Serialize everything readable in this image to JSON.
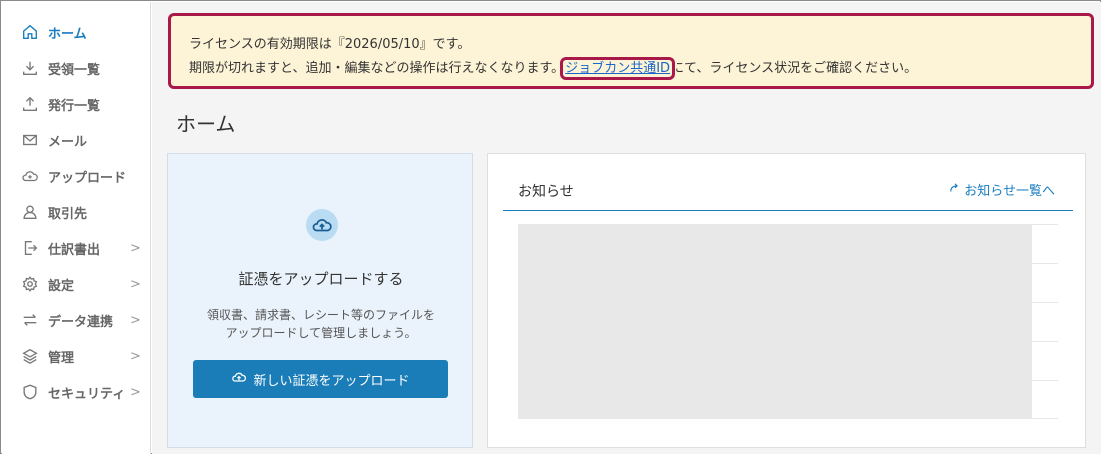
{
  "sidebar": {
    "items": [
      {
        "label": "ホーム",
        "icon": "home-icon",
        "active": true,
        "chevron": ""
      },
      {
        "label": "受領一覧",
        "icon": "download-icon",
        "active": false,
        "chevron": ""
      },
      {
        "label": "発行一覧",
        "icon": "upload-icon",
        "active": false,
        "chevron": ""
      },
      {
        "label": "メール",
        "icon": "mail-icon",
        "active": false,
        "chevron": ""
      },
      {
        "label": "アップロード",
        "icon": "cloud-upload-icon",
        "active": false,
        "chevron": ""
      },
      {
        "label": "取引先",
        "icon": "user-icon",
        "active": false,
        "chevron": ""
      },
      {
        "label": "仕訳書出",
        "icon": "export-icon",
        "active": false,
        "chevron": ">"
      },
      {
        "label": "設定",
        "icon": "gear-icon",
        "active": false,
        "chevron": ">"
      },
      {
        "label": "データ連携",
        "icon": "sync-icon",
        "active": false,
        "chevron": ">"
      },
      {
        "label": "管理",
        "icon": "layers-icon",
        "active": false,
        "chevron": ">"
      },
      {
        "label": "セキュリティ",
        "icon": "shield-icon",
        "active": false,
        "chevron": ">"
      }
    ]
  },
  "banner": {
    "line1": "ライセンスの有効期限は『2026/05/10』です。",
    "line2_before": "期限が切れますと、追加・編集などの操作は行えなくなります。",
    "link": "ジョブカン共通ID",
    "line2_after": "にて、ライセンス状況をご確認ください。"
  },
  "page": {
    "title": "ホーム"
  },
  "upload_card": {
    "title": "証憑をアップロードする",
    "desc_line1": "領収書、請求書、レシート等のファイルを",
    "desc_line2": "アップロードして管理しましょう。",
    "button_label": "新しい証憑をアップロード"
  },
  "news": {
    "title": "お知らせ",
    "link": "お知らせ一覧へ"
  },
  "colors": {
    "accent": "#1a7dc0",
    "banner_bg": "#fdf3d6",
    "highlight_border": "#a8194a",
    "button_bg": "#1a7db8"
  }
}
